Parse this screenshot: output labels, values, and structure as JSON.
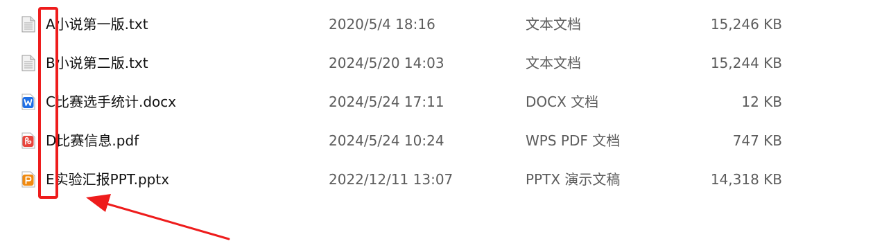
{
  "files": [
    {
      "name": "A小说第一版.txt",
      "modified": "2020/5/4 18:16",
      "type": "文本文档",
      "size": "15,246 KB",
      "icon": "text-file-icon"
    },
    {
      "name": "B小说第二版.txt",
      "modified": "2024/5/20 14:03",
      "type": "文本文档",
      "size": "15,244 KB",
      "icon": "text-file-icon"
    },
    {
      "name": "C比赛选手统计.docx",
      "modified": "2024/5/24 17:11",
      "type": "DOCX 文档",
      "size": "12 KB",
      "icon": "wps-writer-icon"
    },
    {
      "name": "D比赛信息.pdf",
      "modified": "2024/5/24 10:24",
      "type": "WPS PDF 文档",
      "size": "747 KB",
      "icon": "wps-pdf-icon"
    },
    {
      "name": "E实验汇报PPT.pptx",
      "modified": "2022/12/11 13:07",
      "type": "PPTX 演示文稿",
      "size": "14,318 KB",
      "icon": "wps-presentation-icon"
    }
  ],
  "colors": {
    "annotation": "#ee1c1c",
    "writer": "#1f6fe5",
    "pdf": "#e8453c",
    "presentation": "#f08a10"
  }
}
